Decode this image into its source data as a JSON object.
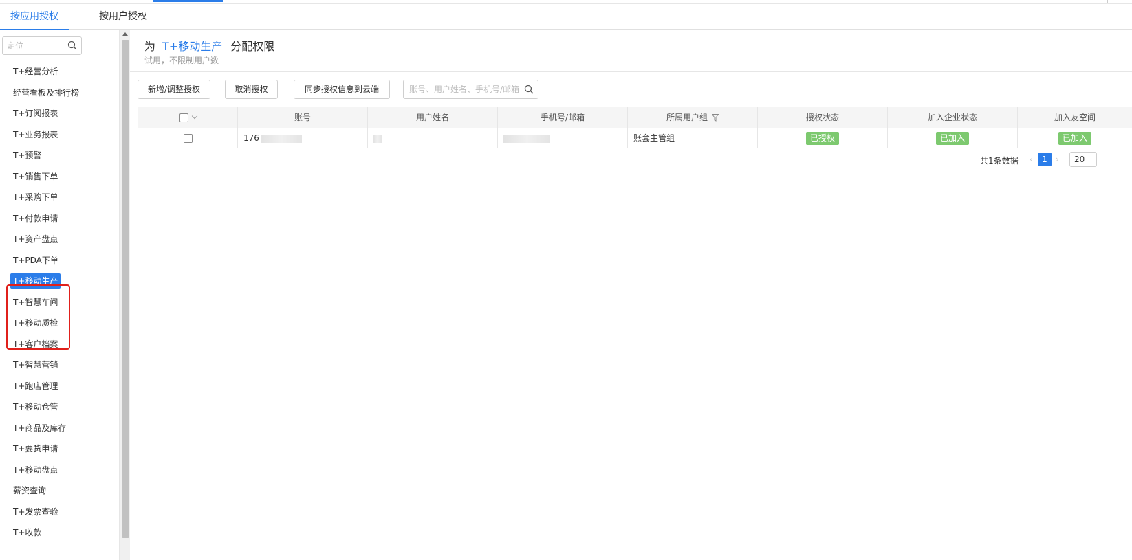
{
  "tabs": {
    "by_app": "按应用授权",
    "by_user": "按用户授权"
  },
  "sidebar": {
    "search_placeholder": "定位",
    "items": [
      "T+经营分析",
      "经营看板及排行榜",
      "T+订阅报表",
      "T+业务报表",
      "T+预警",
      "T+销售下单",
      "T+采购下单",
      "T+付款申请",
      "T+资产盘点",
      "T+PDA下单",
      "T+移动生产",
      "T+智慧车间",
      "T+移动质检",
      "T+客户档案",
      "T+智慧营销",
      "T+跑店管理",
      "T+移动仓管",
      "T+商品及库存",
      "T+要货申请",
      "T+移动盘点",
      "薪资查询",
      "T+发票查验",
      "T+收款"
    ],
    "active_index": 10
  },
  "header": {
    "prefix": "为",
    "app_name": "T+移动生产",
    "suffix": "分配权限",
    "subtitle": "试用，不限制用户数"
  },
  "toolbar": {
    "add_label": "新增/调整授权",
    "cancel_label": "取消授权",
    "sync_label": "同步授权信息到云端",
    "search_placeholder": "账号、用户姓名、手机号/邮箱"
  },
  "table": {
    "columns": [
      "账号",
      "用户姓名",
      "手机号/邮箱",
      "所属用户组",
      "授权状态",
      "加入企业状态",
      "加入友空间"
    ],
    "rows": [
      {
        "account": "176",
        "name": "",
        "contact": "",
        "group": "账套主管组",
        "auth_status": "已授权",
        "enterprise_status": "已加入",
        "space_status": "已加入"
      }
    ]
  },
  "pager": {
    "total": "共1条数据",
    "current": "1",
    "size": "20"
  },
  "colors": {
    "accent": "#2b7de9",
    "success": "#7dc96f",
    "highlight_box": "#e0201b"
  }
}
